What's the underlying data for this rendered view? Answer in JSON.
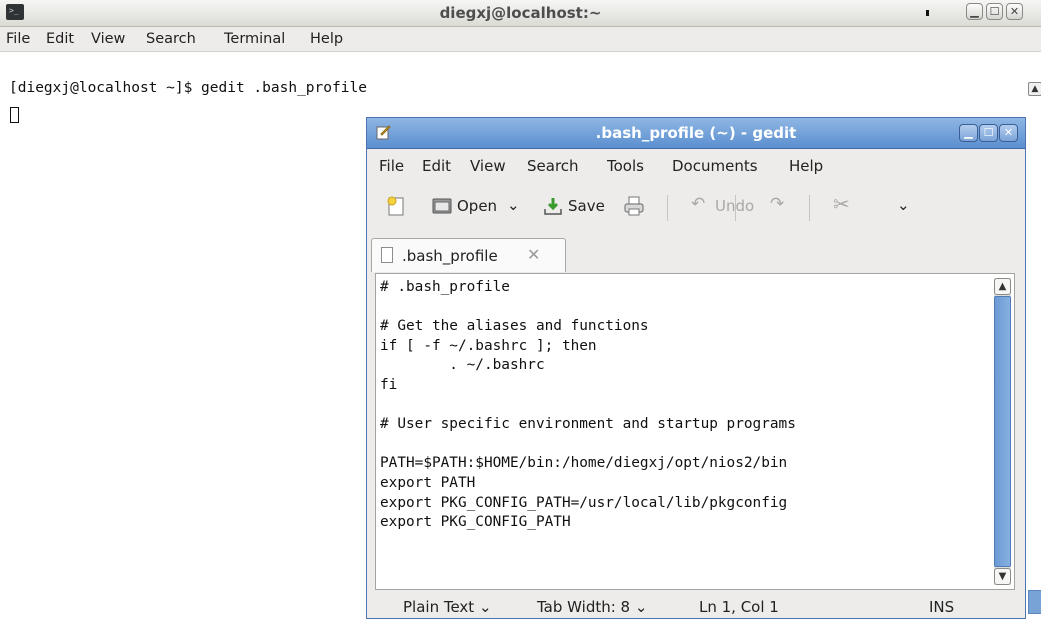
{
  "terminal": {
    "title": "diegxj@localhost:~",
    "menu": [
      "File",
      "Edit",
      "View",
      "Search",
      "Terminal",
      "Help"
    ],
    "menu_mnemonics": [
      "F",
      "E",
      "V",
      "S",
      "T",
      "H"
    ],
    "prompt_line": "[diegxj@localhost ~]$ gedit .bash_profile"
  },
  "gedit": {
    "title": ".bash_profile (~) - gedit",
    "menu": [
      "File",
      "Edit",
      "View",
      "Search",
      "Tools",
      "Documents",
      "Help"
    ],
    "toolbar": {
      "open_label": "Open",
      "save_label": "Save",
      "undo_label": "Undo"
    },
    "tab": {
      "label": ".bash_profile",
      "close_glyph": "✕"
    },
    "editor_lines": [
      "# .bash_profile",
      "",
      "# Get the aliases and functions",
      "if [ -f ~/.bashrc ]; then",
      "        . ~/.bashrc",
      "fi",
      "",
      "# User specific environment and startup programs",
      "",
      "PATH=$PATH:$HOME/bin:/home/diegxj/opt/nios2/bin",
      "export PATH",
      "export PKG_CONFIG_PATH=/usr/local/lib/pkgconfig",
      "export PKG_CONFIG_PATH"
    ],
    "status": {
      "language": "Plain Text ⌄",
      "tab_width": "Tab Width:  8 ⌄",
      "position": "Ln 1, Col 1",
      "mode": "INS"
    }
  },
  "colors": {
    "gedit_titlebar": "#6f9fd9",
    "selection_blue": "#78a3d6"
  }
}
